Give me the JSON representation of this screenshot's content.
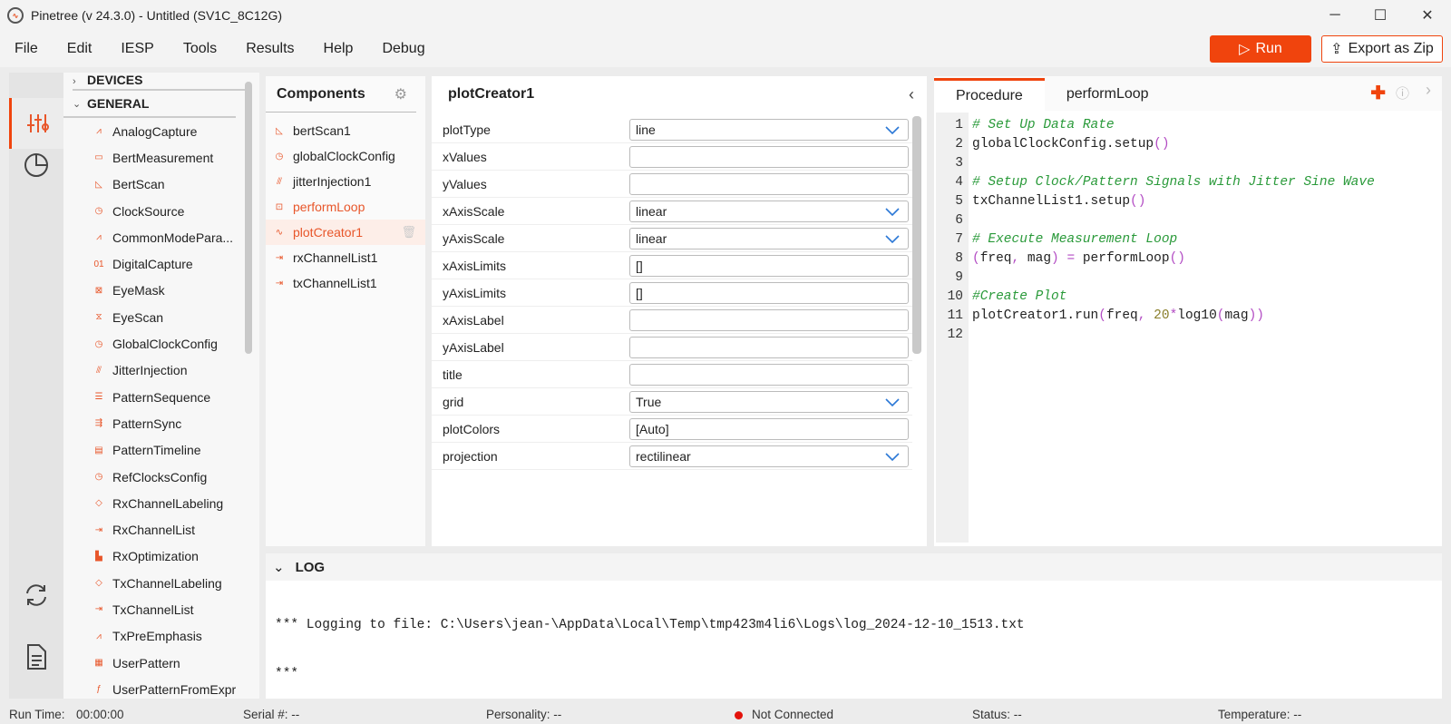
{
  "window": {
    "title": "Pinetree (v 24.3.0) - Untitled (SV1C_8C12G)",
    "minimize": "─",
    "maximize": "☐",
    "close": "✕"
  },
  "menu": [
    "File",
    "Edit",
    "IESP",
    "Tools",
    "Results",
    "Help",
    "Debug"
  ],
  "toolbar": {
    "run_label": "Run",
    "export_label": "Export as Zip"
  },
  "palette": {
    "sections": [
      {
        "label": "DEVICES",
        "expanded": false
      },
      {
        "label": "GENERAL",
        "expanded": true
      }
    ],
    "items": [
      {
        "label": "AnalogCapture",
        "icon": "analog-wave-icon"
      },
      {
        "label": "BertMeasurement",
        "icon": "bert-icon"
      },
      {
        "label": "BertScan",
        "icon": "scan-icon"
      },
      {
        "label": "ClockSource",
        "icon": "clock-icon"
      },
      {
        "label": "CommonModePara...",
        "icon": "wave-icon"
      },
      {
        "label": "DigitalCapture",
        "icon": "binary-icon"
      },
      {
        "label": "EyeMask",
        "icon": "eye-mask-icon"
      },
      {
        "label": "EyeScan",
        "icon": "eye-scan-icon"
      },
      {
        "label": "GlobalClockConfig",
        "icon": "clock-icon"
      },
      {
        "label": "JitterInjection",
        "icon": "jitter-icon"
      },
      {
        "label": "PatternSequence",
        "icon": "sequence-icon"
      },
      {
        "label": "PatternSync",
        "icon": "sync-icon"
      },
      {
        "label": "PatternTimeline",
        "icon": "timeline-icon"
      },
      {
        "label": "RefClocksConfig",
        "icon": "clock-icon"
      },
      {
        "label": "RxChannelLabeling",
        "icon": "tag-icon"
      },
      {
        "label": "RxChannelList",
        "icon": "channel-list-icon"
      },
      {
        "label": "RxOptimization",
        "icon": "bars-icon"
      },
      {
        "label": "TxChannelLabeling",
        "icon": "tag-icon"
      },
      {
        "label": "TxChannelList",
        "icon": "channel-list-icon"
      },
      {
        "label": "TxPreEmphasis",
        "icon": "wave-icon"
      },
      {
        "label": "UserPattern",
        "icon": "pattern-icon"
      },
      {
        "label": "UserPatternFromExpr",
        "icon": "function-icon"
      }
    ]
  },
  "components": {
    "title": "Components",
    "items": [
      {
        "label": "bertScan1",
        "icon": "scan-icon",
        "state": "normal"
      },
      {
        "label": "globalClockConfig",
        "icon": "clock-icon",
        "state": "normal"
      },
      {
        "label": "jitterInjection1",
        "icon": "jitter-icon",
        "state": "normal"
      },
      {
        "label": "performLoop",
        "icon": "loop-icon",
        "state": "highlight"
      },
      {
        "label": "plotCreator1",
        "icon": "plot-icon",
        "state": "selected"
      },
      {
        "label": "rxChannelList1",
        "icon": "channel-list-icon",
        "state": "normal"
      },
      {
        "label": "txChannelList1",
        "icon": "channel-list-icon",
        "state": "normal"
      }
    ]
  },
  "properties": {
    "title": "plotCreator1",
    "rows": [
      {
        "label": "plotType",
        "value": "line",
        "dropdown": true
      },
      {
        "label": "xValues",
        "value": "",
        "dropdown": false
      },
      {
        "label": "yValues",
        "value": "",
        "dropdown": false
      },
      {
        "label": "xAxisScale",
        "value": "linear",
        "dropdown": true
      },
      {
        "label": "yAxisScale",
        "value": "linear",
        "dropdown": true
      },
      {
        "label": "xAxisLimits",
        "value": "[]",
        "dropdown": false
      },
      {
        "label": "yAxisLimits",
        "value": "[]",
        "dropdown": false
      },
      {
        "label": "xAxisLabel",
        "value": "",
        "dropdown": false
      },
      {
        "label": "yAxisLabel",
        "value": "",
        "dropdown": false
      },
      {
        "label": "title",
        "value": "",
        "dropdown": false
      },
      {
        "label": "grid",
        "value": "True",
        "dropdown": true
      },
      {
        "label": "plotColors",
        "value": "[Auto]",
        "dropdown": false
      },
      {
        "label": "projection",
        "value": "rectilinear",
        "dropdown": true
      }
    ]
  },
  "editor": {
    "tabs": [
      {
        "label": "Procedure",
        "active": true
      },
      {
        "label": "performLoop",
        "active": false
      }
    ],
    "line_numbers": [
      "1",
      "2",
      "3",
      "4",
      "5",
      "6",
      "7",
      "8",
      "9",
      "10",
      "11",
      "12"
    ],
    "code": [
      [
        {
          "t": "# Set Up Data Rate",
          "c": "cm"
        }
      ],
      [
        {
          "t": "globalClockConfig.setup",
          "c": ""
        },
        {
          "t": "()",
          "c": "pn"
        }
      ],
      [],
      [
        {
          "t": "# Setup Clock/Pattern Signals with Jitter Sine Wave",
          "c": "cm"
        }
      ],
      [
        {
          "t": "txChannelList1.setup",
          "c": ""
        },
        {
          "t": "()",
          "c": "pn"
        }
      ],
      [],
      [
        {
          "t": "# Execute Measurement Loop",
          "c": "cm"
        }
      ],
      [
        {
          "t": "(",
          "c": "pn"
        },
        {
          "t": "freq",
          "c": ""
        },
        {
          "t": ",",
          "c": "pn"
        },
        {
          "t": " mag",
          "c": ""
        },
        {
          "t": ")",
          "c": "pn"
        },
        {
          "t": " ",
          "c": ""
        },
        {
          "t": "=",
          "c": "pn"
        },
        {
          "t": " performLoop",
          "c": ""
        },
        {
          "t": "()",
          "c": "pn"
        }
      ],
      [],
      [
        {
          "t": "#Create Plot",
          "c": "cm"
        }
      ],
      [
        {
          "t": "plotCreator1.run",
          "c": ""
        },
        {
          "t": "(",
          "c": "pn"
        },
        {
          "t": "freq",
          "c": ""
        },
        {
          "t": ",",
          "c": "pn"
        },
        {
          "t": " ",
          "c": ""
        },
        {
          "t": "20",
          "c": "nm"
        },
        {
          "t": "*",
          "c": "pn"
        },
        {
          "t": "log10",
          "c": ""
        },
        {
          "t": "(",
          "c": "pn"
        },
        {
          "t": "mag",
          "c": ""
        },
        {
          "t": "))",
          "c": "pn"
        }
      ],
      []
    ]
  },
  "log": {
    "title": "LOG",
    "lines": [
      "*** Logging to file: C:\\Users\\jean-\\AppData\\Local\\Temp\\tmp423m4li6\\Logs\\log_2024-12-10_1513.txt",
      "***"
    ]
  },
  "status": {
    "run_time_label": "Run Time:",
    "run_time": "00:00:00",
    "serial": "Serial #: --",
    "personality": "Personality: --",
    "connection": "Not Connected",
    "status": "Status: --",
    "temperature": "Temperature: --",
    "connection_color": "#e3120b"
  },
  "colors": {
    "accent": "#f0440d",
    "dropdown_chevron": "#2b78d6"
  }
}
